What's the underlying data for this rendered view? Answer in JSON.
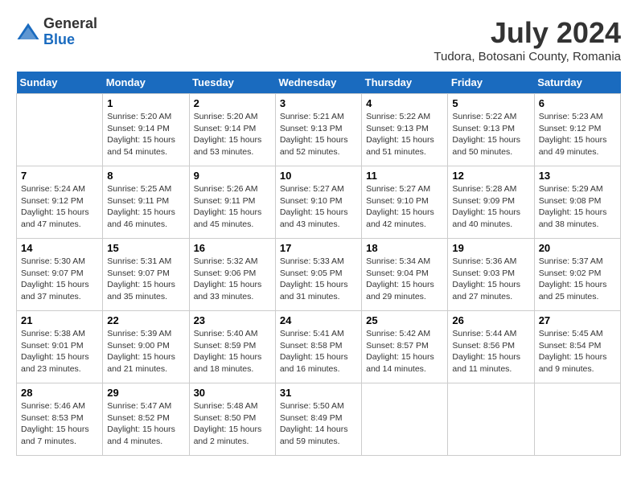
{
  "logo": {
    "general": "General",
    "blue": "Blue"
  },
  "title": "July 2024",
  "location": "Tudora, Botosani County, Romania",
  "days_header": [
    "Sunday",
    "Monday",
    "Tuesday",
    "Wednesday",
    "Thursday",
    "Friday",
    "Saturday"
  ],
  "weeks": [
    [
      {
        "day": "",
        "info": ""
      },
      {
        "day": "1",
        "info": "Sunrise: 5:20 AM\nSunset: 9:14 PM\nDaylight: 15 hours\nand 54 minutes."
      },
      {
        "day": "2",
        "info": "Sunrise: 5:20 AM\nSunset: 9:14 PM\nDaylight: 15 hours\nand 53 minutes."
      },
      {
        "day": "3",
        "info": "Sunrise: 5:21 AM\nSunset: 9:13 PM\nDaylight: 15 hours\nand 52 minutes."
      },
      {
        "day": "4",
        "info": "Sunrise: 5:22 AM\nSunset: 9:13 PM\nDaylight: 15 hours\nand 51 minutes."
      },
      {
        "day": "5",
        "info": "Sunrise: 5:22 AM\nSunset: 9:13 PM\nDaylight: 15 hours\nand 50 minutes."
      },
      {
        "day": "6",
        "info": "Sunrise: 5:23 AM\nSunset: 9:12 PM\nDaylight: 15 hours\nand 49 minutes."
      }
    ],
    [
      {
        "day": "7",
        "info": "Sunrise: 5:24 AM\nSunset: 9:12 PM\nDaylight: 15 hours\nand 47 minutes."
      },
      {
        "day": "8",
        "info": "Sunrise: 5:25 AM\nSunset: 9:11 PM\nDaylight: 15 hours\nand 46 minutes."
      },
      {
        "day": "9",
        "info": "Sunrise: 5:26 AM\nSunset: 9:11 PM\nDaylight: 15 hours\nand 45 minutes."
      },
      {
        "day": "10",
        "info": "Sunrise: 5:27 AM\nSunset: 9:10 PM\nDaylight: 15 hours\nand 43 minutes."
      },
      {
        "day": "11",
        "info": "Sunrise: 5:27 AM\nSunset: 9:10 PM\nDaylight: 15 hours\nand 42 minutes."
      },
      {
        "day": "12",
        "info": "Sunrise: 5:28 AM\nSunset: 9:09 PM\nDaylight: 15 hours\nand 40 minutes."
      },
      {
        "day": "13",
        "info": "Sunrise: 5:29 AM\nSunset: 9:08 PM\nDaylight: 15 hours\nand 38 minutes."
      }
    ],
    [
      {
        "day": "14",
        "info": "Sunrise: 5:30 AM\nSunset: 9:07 PM\nDaylight: 15 hours\nand 37 minutes."
      },
      {
        "day": "15",
        "info": "Sunrise: 5:31 AM\nSunset: 9:07 PM\nDaylight: 15 hours\nand 35 minutes."
      },
      {
        "day": "16",
        "info": "Sunrise: 5:32 AM\nSunset: 9:06 PM\nDaylight: 15 hours\nand 33 minutes."
      },
      {
        "day": "17",
        "info": "Sunrise: 5:33 AM\nSunset: 9:05 PM\nDaylight: 15 hours\nand 31 minutes."
      },
      {
        "day": "18",
        "info": "Sunrise: 5:34 AM\nSunset: 9:04 PM\nDaylight: 15 hours\nand 29 minutes."
      },
      {
        "day": "19",
        "info": "Sunrise: 5:36 AM\nSunset: 9:03 PM\nDaylight: 15 hours\nand 27 minutes."
      },
      {
        "day": "20",
        "info": "Sunrise: 5:37 AM\nSunset: 9:02 PM\nDaylight: 15 hours\nand 25 minutes."
      }
    ],
    [
      {
        "day": "21",
        "info": "Sunrise: 5:38 AM\nSunset: 9:01 PM\nDaylight: 15 hours\nand 23 minutes."
      },
      {
        "day": "22",
        "info": "Sunrise: 5:39 AM\nSunset: 9:00 PM\nDaylight: 15 hours\nand 21 minutes."
      },
      {
        "day": "23",
        "info": "Sunrise: 5:40 AM\nSunset: 8:59 PM\nDaylight: 15 hours\nand 18 minutes."
      },
      {
        "day": "24",
        "info": "Sunrise: 5:41 AM\nSunset: 8:58 PM\nDaylight: 15 hours\nand 16 minutes."
      },
      {
        "day": "25",
        "info": "Sunrise: 5:42 AM\nSunset: 8:57 PM\nDaylight: 15 hours\nand 14 minutes."
      },
      {
        "day": "26",
        "info": "Sunrise: 5:44 AM\nSunset: 8:56 PM\nDaylight: 15 hours\nand 11 minutes."
      },
      {
        "day": "27",
        "info": "Sunrise: 5:45 AM\nSunset: 8:54 PM\nDaylight: 15 hours\nand 9 minutes."
      }
    ],
    [
      {
        "day": "28",
        "info": "Sunrise: 5:46 AM\nSunset: 8:53 PM\nDaylight: 15 hours\nand 7 minutes."
      },
      {
        "day": "29",
        "info": "Sunrise: 5:47 AM\nSunset: 8:52 PM\nDaylight: 15 hours\nand 4 minutes."
      },
      {
        "day": "30",
        "info": "Sunrise: 5:48 AM\nSunset: 8:50 PM\nDaylight: 15 hours\nand 2 minutes."
      },
      {
        "day": "31",
        "info": "Sunrise: 5:50 AM\nSunset: 8:49 PM\nDaylight: 14 hours\nand 59 minutes."
      },
      {
        "day": "",
        "info": ""
      },
      {
        "day": "",
        "info": ""
      },
      {
        "day": "",
        "info": ""
      }
    ]
  ]
}
